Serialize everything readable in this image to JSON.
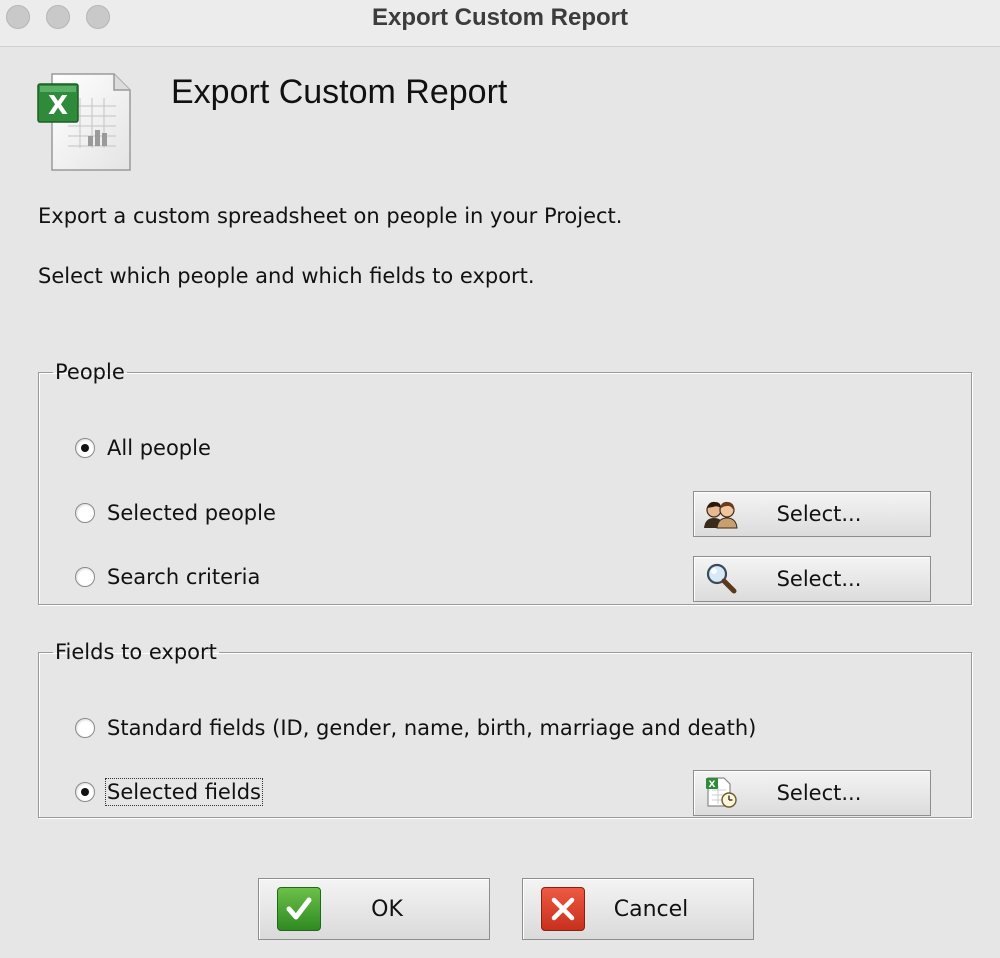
{
  "window": {
    "title": "Export Custom Report"
  },
  "header": {
    "title": "Export Custom Report",
    "icon": "excel-spreadsheet-icon"
  },
  "description": {
    "line1": "Export a custom spreadsheet on people in your Project.",
    "line2": "Select which people and which fields to export."
  },
  "people": {
    "legend": "People",
    "options": [
      {
        "label": "All people",
        "checked": true
      },
      {
        "label": "Selected people",
        "checked": false
      },
      {
        "label": "Search criteria",
        "checked": false
      }
    ],
    "select_people_button": {
      "label": "Select...",
      "icon": "people-icon"
    },
    "select_criteria_button": {
      "label": "Select...",
      "icon": "magnifier-icon"
    }
  },
  "fields": {
    "legend": "Fields to export",
    "options": [
      {
        "label": "Standard fields (ID, gender, name, birth, marriage and death)",
        "checked": false
      },
      {
        "label": "Selected fields",
        "checked": true
      }
    ],
    "select_fields_button": {
      "label": "Select...",
      "icon": "spreadsheet-clock-icon"
    }
  },
  "footer": {
    "ok_label": "OK",
    "cancel_label": "Cancel"
  },
  "colors": {
    "background": "#e6e6e6",
    "ok_green": "#3a9a2a",
    "cancel_red": "#d8402a",
    "excel_green": "#2f8a3a"
  }
}
